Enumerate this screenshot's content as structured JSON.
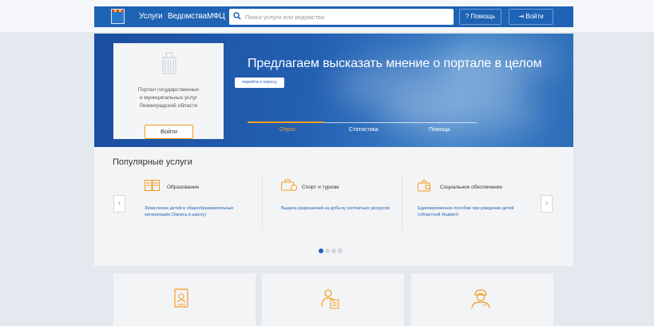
{
  "nav": {
    "links": [
      "Услуги",
      "Ведомства",
      "МФЦ"
    ],
    "search_placeholder": "Поиск услуги или ведомства",
    "help_label": "Помощь",
    "login_label": "Войти"
  },
  "hero": {
    "card_lines": [
      "Портал государственных",
      "и муниципальных услуг",
      "Ленинградской области"
    ],
    "card_login_label": "Войти",
    "title": "Предлагаем высказать мнение о портале в целом",
    "survey_button": "перейти к опросу",
    "tabs": [
      {
        "label": "Опрос",
        "active": true
      },
      {
        "label": "Статистика",
        "active": false
      },
      {
        "label": "Помощь",
        "active": false
      }
    ]
  },
  "popular": {
    "title": "Популярные услуги",
    "prev_icon": "chevron-left-icon",
    "next_icon": "chevron-right-icon",
    "services": [
      {
        "name": "Образование",
        "icon": "book-icon",
        "desc": [
          "Зачисление детей в общеобразовательные",
          "организации (Запись в школу)"
        ]
      },
      {
        "name": "Спорт и туризм",
        "icon": "suitcase-icon",
        "desc": [
          "Выдача разрешений на добычу охотничьих ресурсов"
        ]
      },
      {
        "name": "Социальное обеспечение",
        "icon": "wallet-icon",
        "desc": [
          "Единовременное пособие при рождении детей",
          "(областной бюджет)"
        ]
      }
    ],
    "pagination": {
      "pages": 4,
      "active": 1
    }
  },
  "bottom_cards": [
    "passport-icon",
    "person-document-icon",
    "doctor-icon"
  ],
  "colors": {
    "brand_blue": "#1f63b5",
    "accent_orange": "#f39c1f",
    "page_bg": "#e4e9ef",
    "card_bg": "#f3f4f5"
  }
}
